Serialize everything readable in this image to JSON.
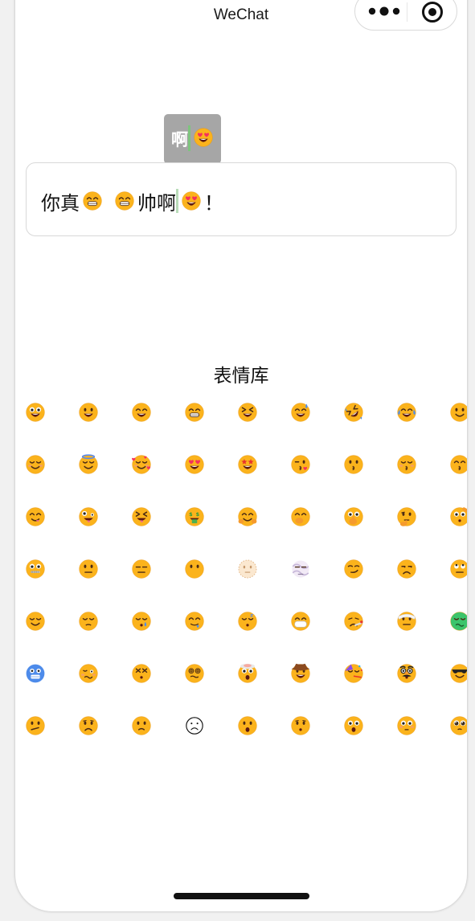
{
  "nav": {
    "title": "WeChat",
    "more_icon": "more-dots-icon",
    "close_icon": "target-close-icon"
  },
  "tooltip": {
    "char": "啊",
    "emoji": "heart-eyes"
  },
  "input": {
    "segments": [
      {
        "type": "text",
        "value": "你真"
      },
      {
        "type": "emoji",
        "name": "grin"
      },
      {
        "type": "gap"
      },
      {
        "type": "emoji",
        "name": "grin"
      },
      {
        "type": "text",
        "value": "帅啊"
      },
      {
        "type": "caret"
      },
      {
        "type": "emoji",
        "name": "heart-eyes"
      },
      {
        "type": "text",
        "value": "！"
      }
    ]
  },
  "emoji_library": {
    "title": "表情库",
    "rows": [
      [
        "grinning-big-eyes",
        "smiley",
        "smile",
        "grin",
        "laughing-squint",
        "sweat-smile",
        "rofl",
        "joy",
        "slight-smile"
      ],
      [
        "blush",
        "innocent",
        "smiling-hearts",
        "heart-eyes",
        "star-struck",
        "kissing-heart",
        "kissing",
        "kissing-closed-eyes",
        "kissing-smiling"
      ],
      [
        "yum",
        "zany",
        "squinting-tongue",
        "money-mouth",
        "hugging",
        "hand-over-mouth",
        "shushing",
        "thinking",
        "saluting"
      ],
      [
        "zipper-mouth",
        "neutral",
        "expressionless",
        "no-mouth",
        "dotted-line",
        "face-in-clouds",
        "smirk",
        "unamused",
        "eye-roll"
      ],
      [
        "relieved",
        "pensive",
        "sleepy",
        "drooling",
        "sleeping",
        "mask",
        "thermometer",
        "head-bandage",
        "nauseated"
      ],
      [
        "cold",
        "woozy",
        "dizzy",
        "spiral-eyes",
        "exploding-head",
        "cowboy",
        "partying",
        "disguised",
        "sunglasses"
      ],
      [
        "confused",
        "worried",
        "slight-frown",
        "frowning-outline",
        "open-mouth",
        "hushed",
        "astonished",
        "flushed",
        "pleading"
      ]
    ]
  },
  "colors": {
    "face": "#FBB31C",
    "face_dark": "#E8930C",
    "tooltip_bg": "#a6a6a6",
    "caret": "#7ec47e",
    "heart": "#F5325C"
  }
}
